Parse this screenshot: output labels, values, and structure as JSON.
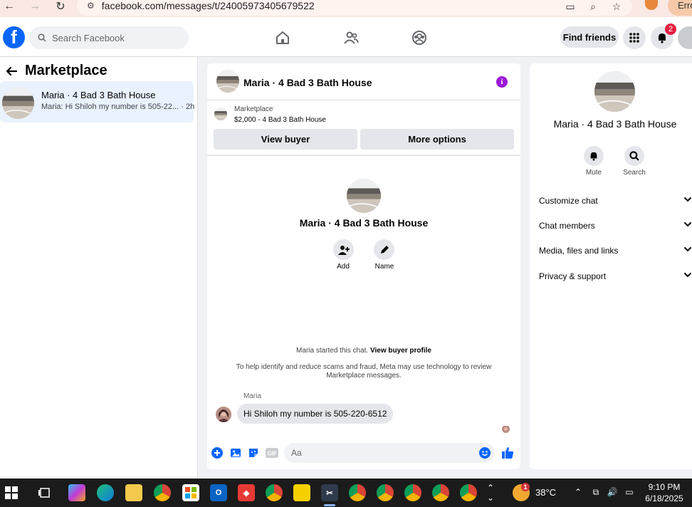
{
  "browser": {
    "url": "facebook.com/messages/t/24005973405679522",
    "profile_pill": "Erro"
  },
  "header": {
    "search_placeholder": "Search Facebook",
    "find_friends": "Find friends",
    "notification_count": "2",
    "brand_color": "#0866ff"
  },
  "sidebar": {
    "title": "Marketplace",
    "conversations": [
      {
        "name": "Maria · 4 Bad 3 Bath House",
        "preview": "Maria: Hi Shiloh my number is 505-22... · 2h"
      }
    ]
  },
  "chat": {
    "title": "Maria · 4 Bad 3 Bath House",
    "listing_label": "Marketplace",
    "listing_price": "$2,000 - 4 Bad 3 Bath House",
    "view_buyer": "View buyer",
    "more_options": "More options",
    "profile_name": "Maria · 4 Bad 3 Bath House",
    "add_label": "Add",
    "name_label": "Name",
    "started_text": "Maria started this chat.",
    "view_buyer_profile": "View buyer profile",
    "disclaimer": "To help identify and reduce scams and fraud, Meta may use technology to review Marketplace messages.",
    "sender": "Maria",
    "message": "Hi Shiloh my number is 505-220-6512",
    "composer_placeholder": "Aa"
  },
  "details": {
    "name": "Maria · 4 Bad 3 Bath House",
    "mute": "Mute",
    "search": "Search",
    "sections": [
      "Customize chat",
      "Chat members",
      "Media, files and links",
      "Privacy & support"
    ]
  },
  "taskbar": {
    "temperature": "38°C",
    "weather_badge": "1",
    "time": "9:10 PM",
    "date": "6/18/2025"
  }
}
